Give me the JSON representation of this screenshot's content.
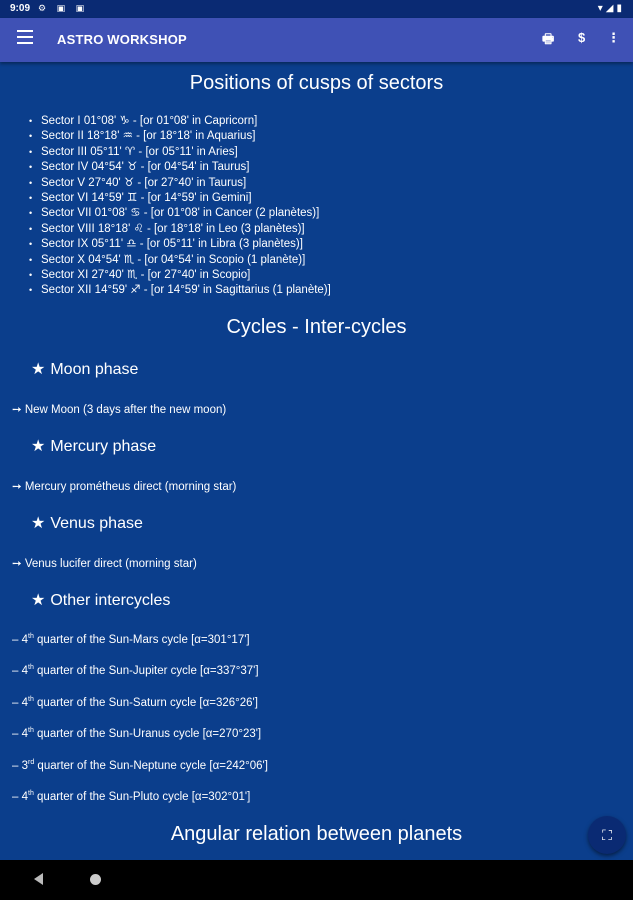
{
  "status": {
    "time": "9:09",
    "left_icons": "⚙ ▣ ▣",
    "right_icons": "▾◢▮"
  },
  "appbar": {
    "title": "ASTRO WORKSHOP",
    "print_icon": "🖶",
    "dollar_label": "$",
    "more_icon": "⋮"
  },
  "section1": {
    "title": "Positions of cusps of sectors"
  },
  "sectors": [
    "Sector I  01°08' ♑ - [or 01°08' in Capricorn]",
    "Sector II  18°18' ♒ - [or 18°18' in Aquarius]",
    "Sector III  05°11' ♈ - [or 05°11' in Aries]",
    "Sector IV  04°54' ♉ - [or 04°54' in Taurus]",
    "Sector V  27°40' ♉ - [or 27°40' in Taurus]",
    "Sector VI  14°59' ♊ - [or 14°59' in Gemini]",
    "Sector VII  01°08' ♋ - [or 01°08' in Cancer (2 planètes)]",
    "Sector VIII  18°18' ♌ - [or 18°18' in Leo (3 planètes)]",
    "Sector IX  05°11' ♎ - [or 05°11' in Libra (3 planètes)]",
    "Sector X  04°54' ♏ - [or 04°54' in Scopio (1 planète)]",
    "Sector XI  27°40' ♏ - [or 27°40' in Scopio]",
    "Sector XII  14°59' ♐ - [or 14°59' in Sagittarius (1 planète)]"
  ],
  "section2": {
    "title": "Cycles - Inter-cycles"
  },
  "phases": {
    "star": "★",
    "arrow": "➙",
    "moon": {
      "title": "Moon phase",
      "text": "New Moon (3 days after the new moon)"
    },
    "mercury": {
      "title": "Mercury phase",
      "text": "Mercury prométheus direct (morning star)"
    },
    "venus": {
      "title": "Venus phase",
      "text": "Venus lucifer direct (morning star)"
    },
    "other": {
      "title": "Other intercycles"
    }
  },
  "intercycles": [
    {
      "num": "4",
      "sup": "th",
      "text": " quarter of the Sun-Mars cycle [α=301°17']"
    },
    {
      "num": "4",
      "sup": "th",
      "text": " quarter of the Sun-Jupiter cycle [α=337°37']"
    },
    {
      "num": "4",
      "sup": "th",
      "text": " quarter of the Sun-Saturn cycle [α=326°26']"
    },
    {
      "num": "4",
      "sup": "th",
      "text": " quarter of the Sun-Uranus cycle [α=270°23']"
    },
    {
      "num": "3",
      "sup": "rd",
      "text": " quarter of the Sun-Neptune cycle [α=242°06']"
    },
    {
      "num": "4",
      "sup": "th",
      "text": " quarter of the Sun-Pluto cycle [α=302°01']"
    }
  ],
  "section3": {
    "title": "Angular relation between planets"
  },
  "fab": {
    "icon": "⛶"
  },
  "colors": {
    "background": "#0b3e8c",
    "appbar": "#3f51b5",
    "statusbar": "#0a2a73"
  }
}
